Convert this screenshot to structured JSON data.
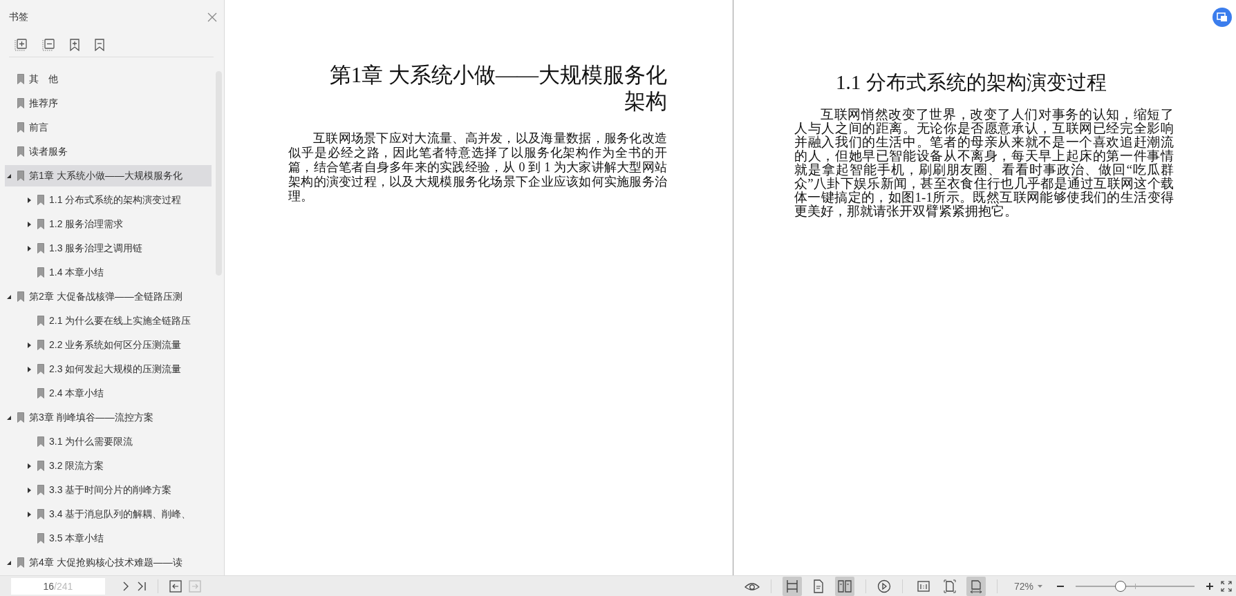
{
  "sidebar": {
    "title": "书签",
    "bookmarks": [
      {
        "label": "其　他",
        "selected": false
      },
      {
        "label": "推荐序",
        "selected": false
      },
      {
        "label": "前言",
        "selected": false
      },
      {
        "label": "读者服务",
        "selected": false
      },
      {
        "label": "第1章 大系统小做——大规模服务化",
        "selected": true,
        "expanded": true,
        "children": [
          {
            "label": "1.1 分布式系统的架构演变过程",
            "selected": false,
            "expanded": false
          },
          {
            "label": "1.2 服务治理需求",
            "selected": false,
            "expanded": false
          },
          {
            "label": "1.3 服务治理之调用链",
            "selected": false,
            "expanded": false
          },
          {
            "label": "1.4 本章小结",
            "selected": false
          }
        ]
      },
      {
        "label": "第2章 大促备战核弹——全链路压测",
        "selected": false,
        "expanded": true,
        "children": [
          {
            "label": "2.1 为什么要在线上实施全链路压",
            "selected": false
          },
          {
            "label": "2.2 业务系统如何区分压测流量",
            "selected": false,
            "expanded": false
          },
          {
            "label": "2.3 如何发起大规模的压测流量",
            "selected": false,
            "expanded": false
          },
          {
            "label": "2.4 本章小结",
            "selected": false
          }
        ]
      },
      {
        "label": "第3章 削峰填谷——流控方案",
        "selected": false,
        "expanded": true,
        "children": [
          {
            "label": "3.1 为什么需要限流",
            "selected": false
          },
          {
            "label": "3.2 限流方案",
            "selected": false,
            "expanded": false
          },
          {
            "label": "3.3 基于时间分片的削峰方案",
            "selected": false,
            "expanded": false
          },
          {
            "label": "3.4 基于消息队列的解耦、削峰、",
            "selected": false,
            "expanded": false
          },
          {
            "label": "3.5 本章小结",
            "selected": false
          }
        ]
      },
      {
        "label": "第4章 大促抢购核心技术难题——读",
        "selected": false,
        "expanded": true
      }
    ]
  },
  "pages": [
    {
      "title": "第1章  大系统小做——大规模服务化架构",
      "kind": "chapter",
      "text": "互联网场景下应对大流量、高并发，以及海量数据，服务化改造似乎是必经之路，因此笔者特意选择了以服务化架构作为全书的开篇，结合笔者自身多年来的实践经验，从 0 到 1 为大家讲解大型网站架构的演变过程，以及大规模服务化场景下企业应该如何实施服务治理。"
    },
    {
      "title": "1.1  分布式系统的架构演变过程",
      "kind": "section",
      "text": "互联网悄然改变了世界，改变了人们对事务的认知，缩短了人与人之间的距离。无论你是否愿意承认，互联网已经完全影响并融入我们的生活中。笔者的母亲从来就不是一个喜欢追赶潮流的人，但她早已智能设备从不离身，每天早上起床的第一件事情就是拿起智能手机，刷刷朋友圈、看看时事政治、做回“吃瓜群众”八卦下娱乐新闻，甚至衣食住行也几乎都是通过互联网这个载体一键搞定的，如图1-1所示。既然互联网能够使我们的生活变得更美好，那就请张开双臂紧紧拥抱它。"
    }
  ],
  "status_bar": {
    "current_page": "16",
    "total_pages": "/241",
    "view_modes": [
      {
        "kind": "continuous",
        "selected": true
      },
      {
        "kind": "single",
        "selected": false
      },
      {
        "kind": "double",
        "selected": true
      }
    ],
    "fit_modes": [
      {
        "kind": "actual",
        "selected": false
      },
      {
        "kind": "page",
        "selected": false
      },
      {
        "kind": "width",
        "selected": true
      }
    ],
    "zoom": {
      "value": "72%",
      "level": 0.37
    }
  }
}
